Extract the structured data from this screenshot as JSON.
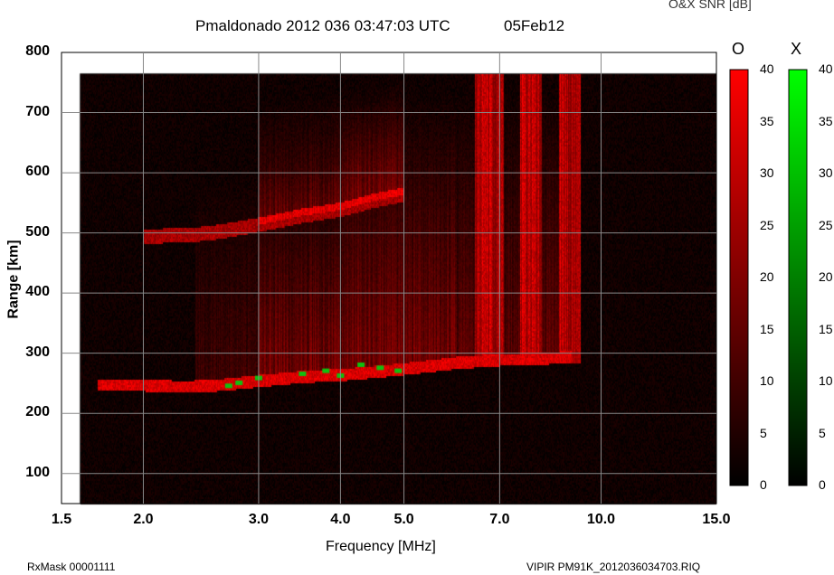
{
  "header": {
    "title": "Pmaldonado 2012 036 03:47:03 UTC",
    "date": "05Feb12",
    "snr_label": "O&X SNR [dB]"
  },
  "footer": {
    "rxmask": "RxMask 00001111",
    "filename": "VIPIR  PM91K_2012036034703.RIQ"
  },
  "chart_data": {
    "type": "heatmap",
    "title": "Pmaldonado 2012 036 03:47:03 UTC",
    "xlabel": "Frequency [MHz]",
    "ylabel": "Range [km]",
    "xscale": "log",
    "xlim": [
      1.5,
      15.0
    ],
    "ylim": [
      50,
      800
    ],
    "xticks": [
      1.5,
      2.0,
      3.0,
      4.0,
      5.0,
      7.0,
      10.0,
      15.0
    ],
    "xtick_labels": [
      "1.5",
      "2.0",
      "3.0",
      "4.0",
      "5.0",
      "7.0",
      "10.0",
      "15.0"
    ],
    "yticks": [
      100,
      200,
      300,
      400,
      500,
      600,
      700,
      800
    ],
    "ytick_labels": [
      "100",
      "200",
      "300",
      "400",
      "500",
      "600",
      "700",
      "800"
    ],
    "grid": true,
    "data_extent": {
      "freq": [
        1.6,
        15.0
      ],
      "range": [
        50,
        765
      ]
    },
    "colorbars": [
      {
        "name": "O",
        "min": 0,
        "max": 40,
        "color": "#ff0000",
        "ticks": [
          "40",
          "35",
          "30",
          "25",
          "20",
          "15",
          "10",
          "5",
          "0"
        ]
      },
      {
        "name": "X",
        "min": 0,
        "max": 40,
        "color": "#00ff00",
        "ticks": [
          "40",
          "35",
          "30",
          "25",
          "20",
          "15",
          "10",
          "5",
          "0"
        ]
      }
    ],
    "o_trace": [
      [
        1.7,
        248
      ],
      [
        2.0,
        248
      ],
      [
        2.3,
        245
      ],
      [
        2.6,
        248
      ],
      [
        3.0,
        255
      ],
      [
        3.5,
        262
      ],
      [
        4.0,
        265
      ],
      [
        4.5,
        270
      ],
      [
        5.0,
        275
      ],
      [
        5.5,
        280
      ],
      [
        6.0,
        285
      ],
      [
        7.0,
        290
      ],
      [
        8.0,
        292
      ],
      [
        9.0,
        295
      ]
    ],
    "o_multi_hop": [
      [
        2.0,
        495
      ],
      [
        2.5,
        500
      ],
      [
        3.0,
        515
      ],
      [
        3.5,
        530
      ],
      [
        4.0,
        540
      ],
      [
        4.5,
        555
      ],
      [
        5.0,
        565
      ]
    ],
    "o_bright_bands_mhz": [
      [
        6.4,
        7.1
      ],
      [
        7.5,
        8.1
      ],
      [
        8.6,
        9.3
      ]
    ],
    "x_echoes": [
      [
        2.7,
        245
      ],
      [
        2.8,
        250
      ],
      [
        3.0,
        258
      ],
      [
        3.5,
        265
      ],
      [
        3.8,
        270
      ],
      [
        4.0,
        262
      ],
      [
        4.3,
        280
      ],
      [
        4.6,
        275
      ],
      [
        4.9,
        270
      ]
    ]
  }
}
